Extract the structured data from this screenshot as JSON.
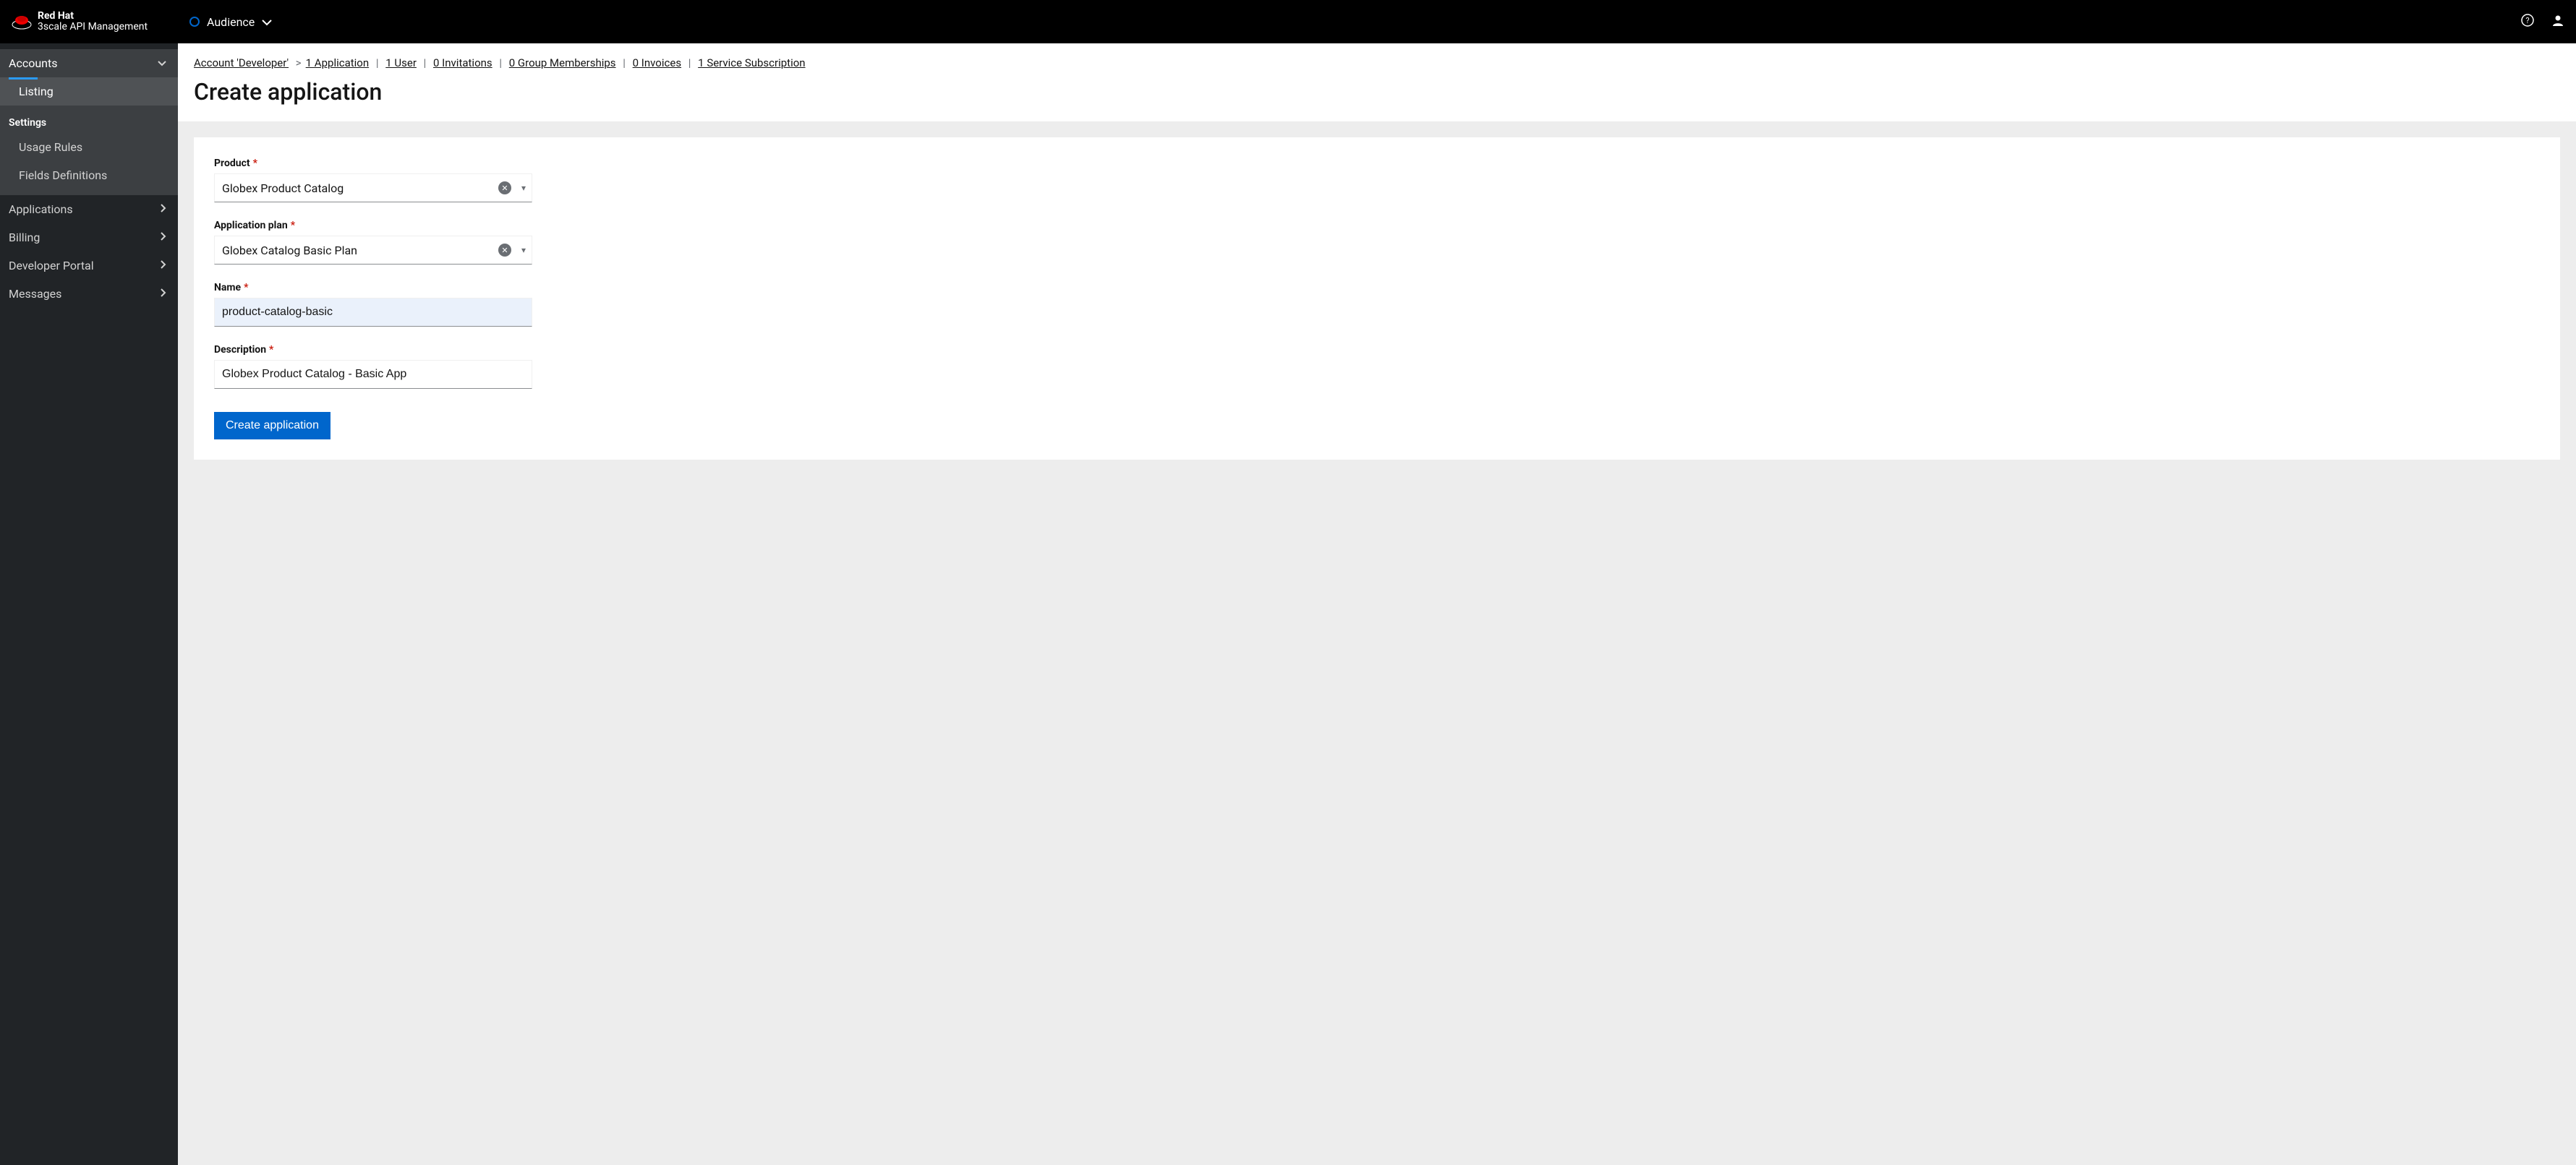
{
  "brand": {
    "line1": "Red Hat",
    "line2": "3scale API Management"
  },
  "header": {
    "context_label": "Audience"
  },
  "sidebar": {
    "accounts_label": "Accounts",
    "listing_label": "Listing",
    "settings_label": "Settings",
    "usage_rules_label": "Usage Rules",
    "fields_defs_label": "Fields Definitions",
    "applications_label": "Applications",
    "billing_label": "Billing",
    "devportal_label": "Developer Portal",
    "messages_label": "Messages"
  },
  "breadcrumbs": {
    "account": "Account 'Developer'",
    "items": [
      "1 Application",
      "1 User",
      "0 Invitations",
      "0 Group Memberships",
      "0 Invoices",
      "1 Service Subscription"
    ]
  },
  "page": {
    "title": "Create application"
  },
  "form": {
    "product": {
      "label": "Product",
      "value": "Globex Product Catalog"
    },
    "plan": {
      "label": "Application plan",
      "value": "Globex Catalog Basic Plan"
    },
    "name": {
      "label": "Name",
      "value": "product-catalog-basic"
    },
    "desc": {
      "label": "Description",
      "value": "Globex Product Catalog - Basic App"
    },
    "submit_label": "Create application",
    "required_marker": "*"
  }
}
